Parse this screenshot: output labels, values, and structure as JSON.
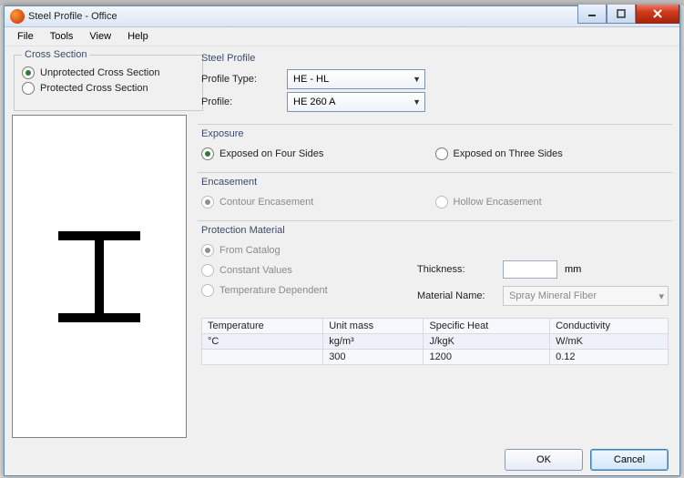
{
  "window": {
    "title": "Steel Profile - Office"
  },
  "menu": {
    "file": "File",
    "tools": "Tools",
    "view": "View",
    "help": "Help"
  },
  "cross_section": {
    "legend": "Cross Section",
    "unprotected": "Unprotected Cross Section",
    "protected": "Protected Cross Section",
    "selected": "unprotected"
  },
  "steel_profile": {
    "legend": "Steel Profile",
    "profile_type_label": "Profile Type:",
    "profile_type_value": "HE - HL",
    "profile_label": "Profile:",
    "profile_value": "HE 260 A"
  },
  "exposure": {
    "legend": "Exposure",
    "four": "Exposed on Four Sides",
    "three": "Exposed on Three Sides",
    "selected": "four"
  },
  "encasement": {
    "legend": "Encasement",
    "contour": "Contour Encasement",
    "hollow": "Hollow Encasement"
  },
  "protection": {
    "legend": "Protection Material",
    "from_catalog": "From Catalog",
    "constant": "Constant Values",
    "temp_dep": "Temperature Dependent",
    "thickness_label": "Thickness:",
    "thickness_value": "",
    "thickness_unit": "mm",
    "material_name_label": "Material Name:",
    "material_name_value": "Spray Mineral Fiber"
  },
  "table": {
    "headers": [
      "Temperature",
      "Unit mass",
      "Specific Heat",
      "Conductivity"
    ],
    "units": [
      "°C",
      "kg/m³",
      "J/kgK",
      "W/mK"
    ],
    "row": [
      "",
      "300",
      "1200",
      "0.12"
    ]
  },
  "buttons": {
    "ok": "OK",
    "cancel": "Cancel"
  }
}
